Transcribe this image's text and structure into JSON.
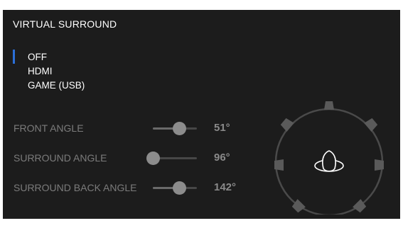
{
  "section": {
    "title": "VIRTUAL SURROUND"
  },
  "options": {
    "items": [
      {
        "label": "OFF",
        "selected": true
      },
      {
        "label": "HDMI",
        "selected": false
      },
      {
        "label": "GAME (USB)",
        "selected": false
      }
    ]
  },
  "sliders": [
    {
      "label": "FRONT ANGLE",
      "value_text": "51°",
      "level": 0.6
    },
    {
      "label": "SURROUND ANGLE",
      "value_text": "96°",
      "level": 0.0
    },
    {
      "label": "SURROUND BACK ANGLE",
      "value_text": "142°",
      "level": 0.6
    }
  ],
  "colors": {
    "background": "#1c1c1c",
    "accent": "#2b6fd8",
    "disabled_text": "#7b7b7b",
    "speaker": "#5a5a5a"
  },
  "icons": {
    "listener": "listener-head-icon",
    "speaker": "speaker-icon"
  }
}
